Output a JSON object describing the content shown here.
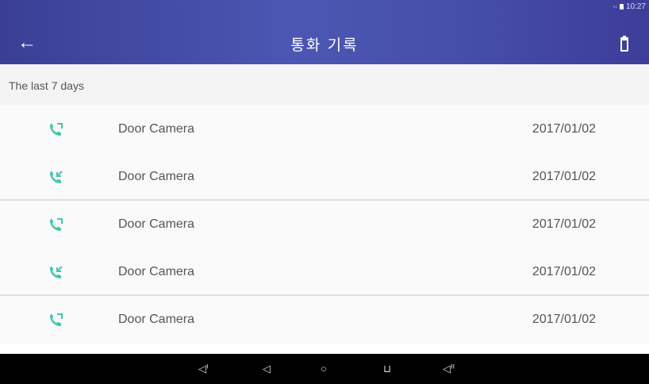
{
  "status_bar": {
    "time": "10:27"
  },
  "header": {
    "title": "통화 기록"
  },
  "section": {
    "label": "The last 7 days"
  },
  "calls": [
    {
      "name": "Door Camera",
      "date": "2017/01/02",
      "type": "outgoing"
    },
    {
      "name": "Door Camera",
      "date": "2017/01/02",
      "type": "incoming"
    },
    {
      "name": "Door Camera",
      "date": "2017/01/02",
      "type": "outgoing"
    },
    {
      "name": "Door Camera",
      "date": "2017/01/02",
      "type": "incoming"
    },
    {
      "name": "Door Camera",
      "date": "2017/01/02",
      "type": "outgoing"
    }
  ],
  "colors": {
    "accent": "#3fc8a8",
    "header_bg": "#4650a8",
    "navbar_bg": "#000000"
  },
  "icons": {
    "back": "arrow-left-icon",
    "delete": "trash-icon",
    "call": "phone-icon",
    "nav": [
      "volume-down-icon",
      "back-triangle-icon",
      "home-circle-icon",
      "recents-square-icon",
      "volume-up-icon"
    ]
  }
}
